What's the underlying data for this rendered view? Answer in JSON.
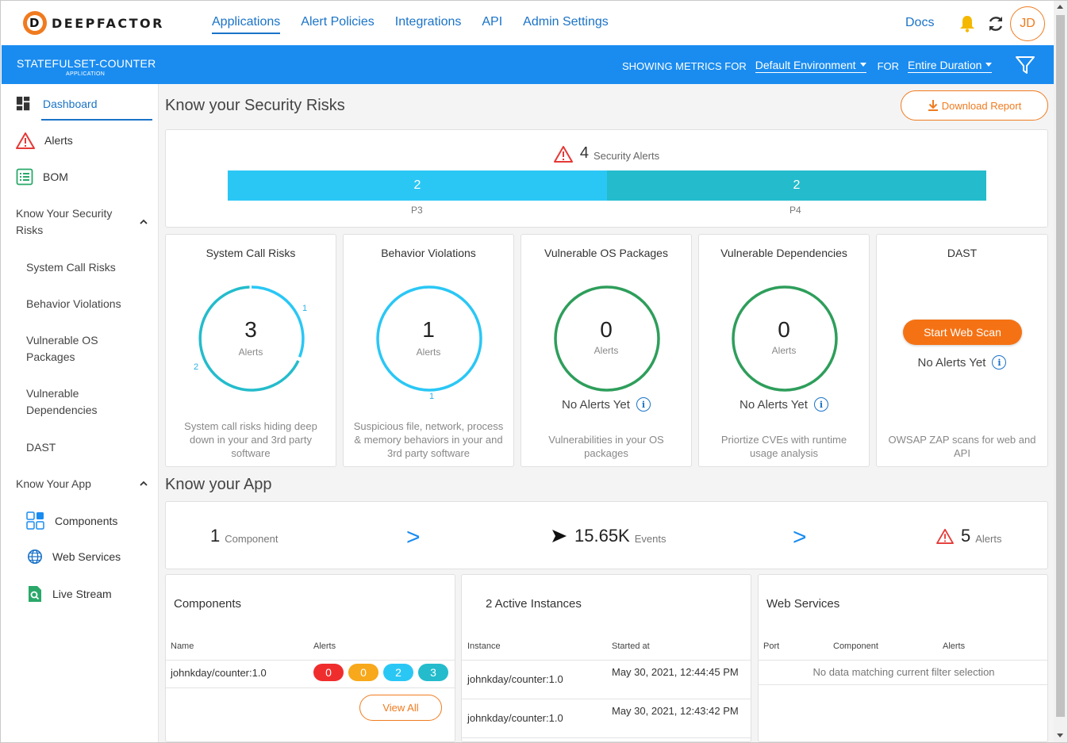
{
  "nav": {
    "logo_text": "DEEPFACTOR",
    "logo_glyph": "D",
    "links": [
      "Applications",
      "Alert Policies",
      "Integrations",
      "API",
      "Admin Settings"
    ],
    "docs": "Docs",
    "avatar": "JD"
  },
  "appbar": {
    "app_name": "STATEFULSET-COUNTER",
    "app_sub": "APPLICATION",
    "showing": "SHOWING METRICS FOR",
    "environment": "Default Environment",
    "for": "FOR",
    "duration": "Entire Duration"
  },
  "sidebar": {
    "dashboard": "Dashboard",
    "alerts": "Alerts",
    "bom": "BOM",
    "group_security": "Know Your Security Risks",
    "security_items": [
      "System Call Risks",
      "Behavior Violations",
      "Vulnerable OS Packages",
      "Vulnerable Dependencies",
      "DAST"
    ],
    "group_app": "Know Your App",
    "app_items": [
      "Components",
      "Web Services",
      "Live Stream"
    ]
  },
  "security": {
    "heading": "Know your Security Risks",
    "download": "Download Report",
    "total": "4",
    "total_label": "Security Alerts",
    "p3_value": "2",
    "p4_value": "2",
    "p3_label": "P3",
    "p4_label": "P4",
    "cards": [
      {
        "title": "System Call Risks",
        "count": "3",
        "unit": "Alerts",
        "seg_a": "1",
        "seg_b": "2",
        "desc": "System call risks hiding deep down in your and 3rd party software"
      },
      {
        "title": "Behavior Violations",
        "count": "1",
        "unit": "Alerts",
        "seg_a": "1",
        "desc": "Suspicious file, network, process & memory behaviors in your and 3rd party software"
      },
      {
        "title": "Vulnerable OS Packages",
        "count": "0",
        "unit": "Alerts",
        "status": "No Alerts Yet",
        "desc": "Vulnerabilities in your OS packages"
      },
      {
        "title": "Vulnerable Dependencies",
        "count": "0",
        "unit": "Alerts",
        "status": "No Alerts Yet",
        "desc": "Priortize CVEs with runtime usage analysis"
      },
      {
        "title": "DAST",
        "button": "Start Web Scan",
        "status": "No Alerts Yet",
        "desc": "OWSAP ZAP scans for web and API"
      }
    ]
  },
  "app": {
    "heading": "Know your App",
    "components_count": "1",
    "components_label": "Component",
    "events_count": "15.65K",
    "events_label": "Events",
    "alerts_count": "5",
    "alerts_label": "Alerts",
    "arrow": ">"
  },
  "components_table": {
    "title": "Components",
    "col_name": "Name",
    "col_alerts": "Alerts",
    "row_name": "johnkday/counter:1.0",
    "pills": [
      "0",
      "0",
      "2",
      "3"
    ],
    "view_all": "View All"
  },
  "instances_table": {
    "title": "2 Active Instances",
    "col_instance": "Instance",
    "col_started": "Started at",
    "rows": [
      {
        "instance": "johnkday/counter:1.0",
        "started": "May 30, 2021, 12:44:45 PM"
      },
      {
        "instance": "johnkday/counter:1.0",
        "started": "May 30, 2021, 12:43:42 PM"
      }
    ]
  },
  "webservices_table": {
    "title": "Web Services",
    "col_port": "Port",
    "col_component": "Component",
    "col_alerts": "Alerts",
    "empty": "No data matching current filter selection"
  },
  "colors": {
    "brand_orange": "#f07b1f",
    "brand_blue": "#1a8cf0",
    "p3": "#2ac7f5",
    "p4": "#24bccc",
    "green": "#2e9e5b"
  }
}
